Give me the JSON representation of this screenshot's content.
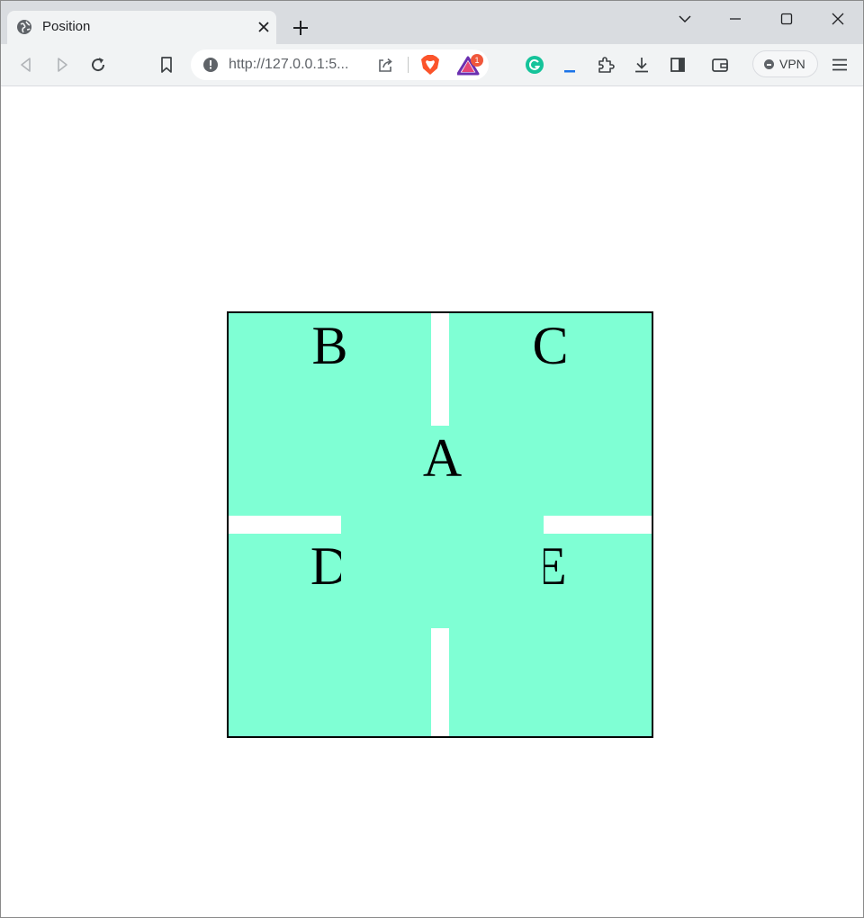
{
  "browser": {
    "tab": {
      "title": "Position",
      "favicon": "globe-icon"
    },
    "address_bar": {
      "url": "http://127.0.0.1:5..."
    },
    "rewards_badge": "1",
    "vpn_label": "VPN"
  },
  "page": {
    "boxes": {
      "a": "A",
      "b": "B",
      "c": "C",
      "d": "D",
      "e": "E"
    },
    "box_color": "#7fffd4",
    "border_color": "#000000"
  }
}
